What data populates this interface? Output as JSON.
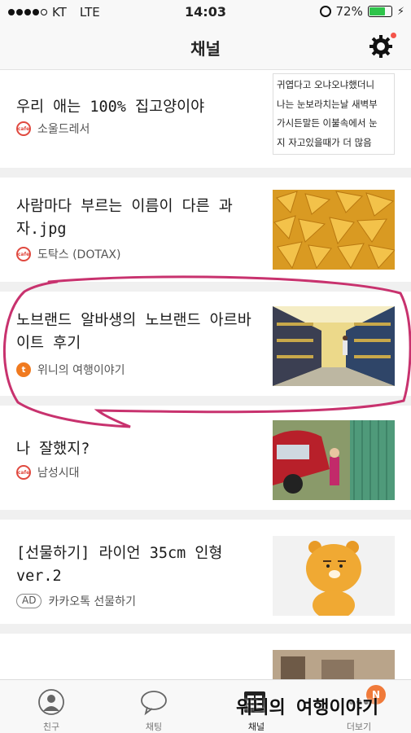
{
  "status_bar": {
    "carrier": "KT",
    "network": "LTE",
    "time": "14:03",
    "battery": "72%"
  },
  "header": {
    "title": "채널"
  },
  "feed": [
    {
      "title": "우리 애는 100% 집고양이야",
      "source": "소울드레서",
      "thumbnail_text": [
        "귀엽다고 오냐오냐했더니",
        "나는 눈보라치는날 새벽부",
        "가시든말든 이불속에서 눈",
        "지 자고있을때가 더 많음"
      ]
    },
    {
      "title": "사람마다 부르는 이름이 다른 과자.jpg",
      "source": "도탁스 (DOTAX)"
    },
    {
      "title": "노브랜드 알바생의 노브랜드 아르바이트 후기",
      "source": "위니의 여행이야기"
    },
    {
      "title": "나 잘했지?",
      "source": "남성시대"
    },
    {
      "title": "[선물하기] 라이언 35cm 인형 ver.2",
      "ad_label": "AD",
      "source": "카카오톡 선물하기"
    }
  ],
  "tabs": [
    {
      "label": "친구",
      "icon": "person-icon"
    },
    {
      "label": "채팅",
      "icon": "speech-bubble-icon"
    },
    {
      "label": "채널",
      "icon": "channel-list-icon"
    },
    {
      "label": "더보기",
      "icon": "more-icon",
      "badge": "N"
    }
  ],
  "caption": "위니의 여행이야기",
  "colors": {
    "accent_annotation": "#c8326e",
    "source_icon_red": "#e0493f",
    "source_icon_orange": "#f07a1f",
    "battery_green": "#2ec44a"
  }
}
